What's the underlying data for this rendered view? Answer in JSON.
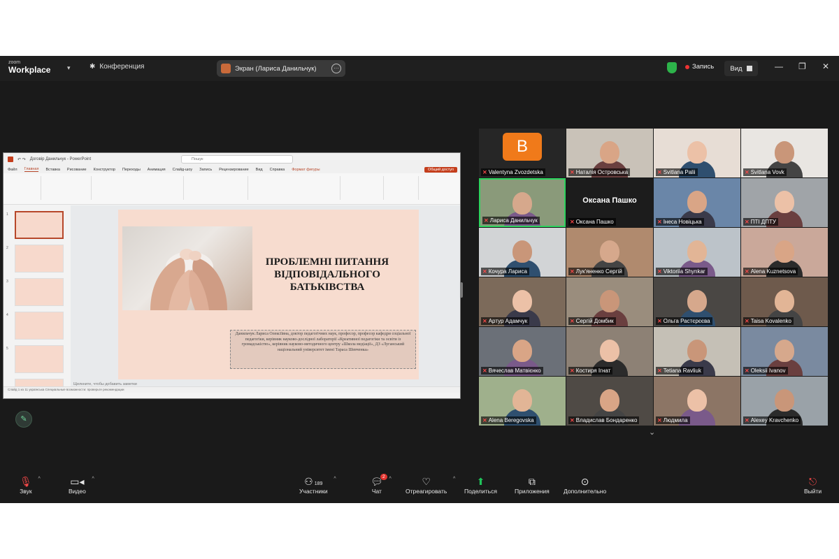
{
  "app": {
    "logo_top": "zoom",
    "logo_bottom": "Workplace",
    "meeting_label": "Конференция",
    "screen_pill": "Экран (Лариса Данильчук)",
    "record_label": "Запись",
    "view_label": "Вид"
  },
  "ppt": {
    "window_title": "Договір Данильчук - PowerPoint",
    "search_placeholder": "Пошук",
    "menu": [
      "Файл",
      "Главная",
      "Вставка",
      "Рисование",
      "Конструктор",
      "Переходы",
      "Анимация",
      "Слайд-шоу",
      "Запись",
      "Рецензирование",
      "Вид",
      "Справка",
      "Формат фигуры"
    ],
    "active_menu": "Главная",
    "share_label": "Общий доступ",
    "slide_title": "ПРОБЛЕМНІ ПИТАННЯ ВІДПОВІДАЛЬНОГО БАТЬКІВСТВА",
    "slide_subtitle": "Данильчук Лариса Олексіївна, доктор педагогічних наук, професор, професор кафедри соціальної педагогіки, керівник науково-дослідної лабораторії «Креативної педагогіки та освіти із громадськістю», керівник науково-методичного центру «Школа медіації», ДЗ «Луганський національний університет імені Тараса Шевченка»",
    "notes_placeholder": "Щелкните, чтобы добавить заметки",
    "status_text": "Слайд 1 из 11   українська   Специальные возможности: проверьте рекомендации"
  },
  "participants": [
    {
      "name": "Valentyna Zvozdetska",
      "type": "avatar",
      "letter": "B"
    },
    {
      "name": "Наталія Островська",
      "type": "video"
    },
    {
      "name": "Svitlana Palii",
      "type": "video"
    },
    {
      "name": "Svitlana Vovk",
      "type": "video"
    },
    {
      "name": "Лариса Данильчук",
      "type": "video",
      "active": true
    },
    {
      "name": "Оксана Пашко",
      "type": "name",
      "display": "Оксана Пашко"
    },
    {
      "name": "Інеса Новіцька",
      "type": "video"
    },
    {
      "name": "ПТІ ДПТУ",
      "type": "video"
    },
    {
      "name": "Кочура Лариса",
      "type": "video"
    },
    {
      "name": "Лук'яненко Сергій",
      "type": "video"
    },
    {
      "name": "Viktoriia Shynkar",
      "type": "video"
    },
    {
      "name": "Alena Kuznetsova",
      "type": "video"
    },
    {
      "name": "Артур Адамчук",
      "type": "video"
    },
    {
      "name": "Сергій Домбик",
      "type": "video"
    },
    {
      "name": "Ольга Растєрєєва",
      "type": "video"
    },
    {
      "name": "Taisa Kovalenko",
      "type": "video"
    },
    {
      "name": "Вячеслав Матвієнко",
      "type": "video"
    },
    {
      "name": "Костиря Ігнат",
      "type": "video"
    },
    {
      "name": "Tetiana Ravliuk",
      "type": "video"
    },
    {
      "name": "Oleksii Ivanov",
      "type": "video"
    },
    {
      "name": "Alena Beregovska",
      "type": "video"
    },
    {
      "name": "Владислав Бондаренко",
      "type": "video"
    },
    {
      "name": "Людмила",
      "type": "video"
    },
    {
      "name": "Alexey Kravchenko",
      "type": "video"
    }
  ],
  "toolbar": {
    "audio": "Звук",
    "video": "Видео",
    "participants": "Участники",
    "participants_count": "189",
    "chat": "Чат",
    "chat_badge": "2",
    "react": "Отреагировать",
    "share": "Поделиться",
    "apps": "Приложения",
    "more": "Дополнительно",
    "leave": "Выйти"
  }
}
